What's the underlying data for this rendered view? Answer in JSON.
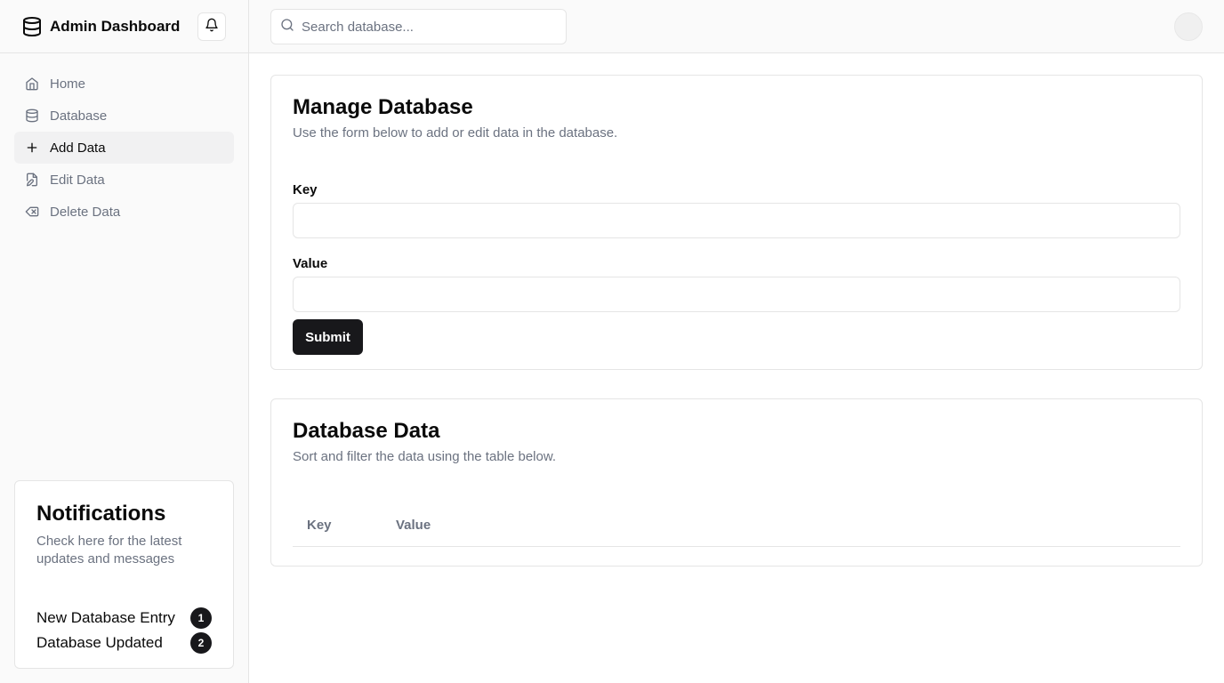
{
  "app": {
    "title": "Admin Dashboard"
  },
  "sidebar": {
    "items": [
      {
        "label": "Home",
        "icon": "home-icon"
      },
      {
        "label": "Database",
        "icon": "database-icon"
      },
      {
        "label": "Add Data",
        "icon": "plus-icon",
        "active": true
      },
      {
        "label": "Edit Data",
        "icon": "file-edit-icon"
      },
      {
        "label": "Delete Data",
        "icon": "delete-icon"
      }
    ]
  },
  "notifications": {
    "title": "Notifications",
    "description": "Check here for the latest updates and messages",
    "items": [
      {
        "label": "New Database Entry",
        "count": "1"
      },
      {
        "label": "Database Updated",
        "count": "2"
      }
    ]
  },
  "search": {
    "placeholder": "Search database...",
    "value": ""
  },
  "manage": {
    "title": "Manage Database",
    "description": "Use the form below to add or edit data in the database.",
    "key_label": "Key",
    "key_value": "",
    "value_label": "Value",
    "value_value": "",
    "submit_label": "Submit"
  },
  "data_table": {
    "title": "Database Data",
    "description": "Sort and filter the data using the table below.",
    "columns": [
      "Key",
      "Value"
    ],
    "rows": []
  },
  "colors": {
    "primary": "#18181b",
    "muted_text": "#6b7280",
    "border": "#e5e5e5",
    "sidebar_bg": "#fafafa",
    "active_bg": "#f1f1f2"
  }
}
